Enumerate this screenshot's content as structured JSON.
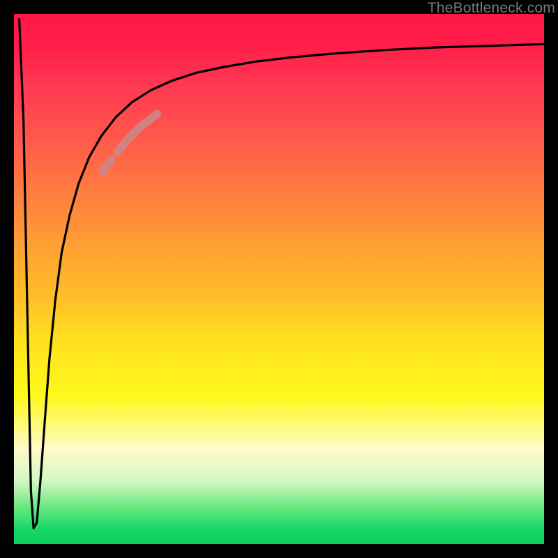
{
  "watermark": "TheBottleneck.com",
  "chart_data": {
    "type": "line",
    "title": "",
    "xlabel": "",
    "ylabel": "",
    "xlim": [
      0,
      100
    ],
    "ylim": [
      0,
      100
    ],
    "grid": false,
    "legend": false,
    "series": [
      {
        "name": "main-curve",
        "color": "#000000",
        "x": [
          1.0,
          1.8,
          2.3,
          2.8,
          3.2,
          3.7,
          4.3,
          5.0,
          5.8,
          6.7,
          7.8,
          9.0,
          10.5,
          12.2,
          14.2,
          16.5,
          19.2,
          22.2,
          25.8,
          29.8,
          34.4,
          39.6,
          45.5,
          52.2,
          60.0,
          70.0,
          80.0,
          90.0,
          100.0
        ],
        "y": [
          99.0,
          80.0,
          55.0,
          30.0,
          10.0,
          3.0,
          4.0,
          12.0,
          23.0,
          35.0,
          46.0,
          55.0,
          62.0,
          68.0,
          73.0,
          77.0,
          80.5,
          83.3,
          85.6,
          87.4,
          88.9,
          90.0,
          91.0,
          91.8,
          92.5,
          93.2,
          93.7,
          94.0,
          94.3
        ]
      },
      {
        "name": "highlight-a",
        "color": "#c98a8a",
        "x": [
          19.5,
          21.0,
          22.5,
          24.0,
          25.5,
          27.0
        ],
        "y": [
          74.0,
          75.8,
          77.4,
          78.8,
          80.0,
          81.1
        ]
      },
      {
        "name": "highlight-b",
        "color": "#c98a8a",
        "x": [
          16.8,
          17.6,
          18.4
        ],
        "y": [
          70.3,
          71.4,
          72.5
        ]
      }
    ]
  }
}
